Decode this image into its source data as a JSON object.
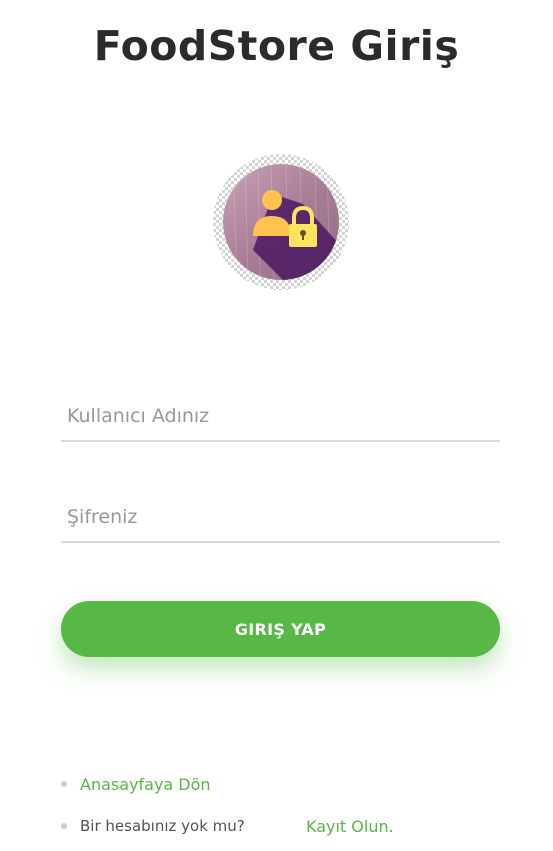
{
  "header": {
    "title": "FoodStore Giriş"
  },
  "avatar": {
    "icon": "user-lock-icon"
  },
  "form": {
    "username_placeholder": "Kullanıcı Adınız",
    "password_placeholder": "Şifreniz",
    "submit_label": "GIRIŞ YAP"
  },
  "links": {
    "home_label": "Anasayfaya Dön",
    "no_account_text": "Bir hesabınız yok mu?",
    "register_label": "Kayıt Olun."
  },
  "colors": {
    "accent": "#57b846",
    "title": "#2b2b2b",
    "placeholder": "#999999"
  }
}
